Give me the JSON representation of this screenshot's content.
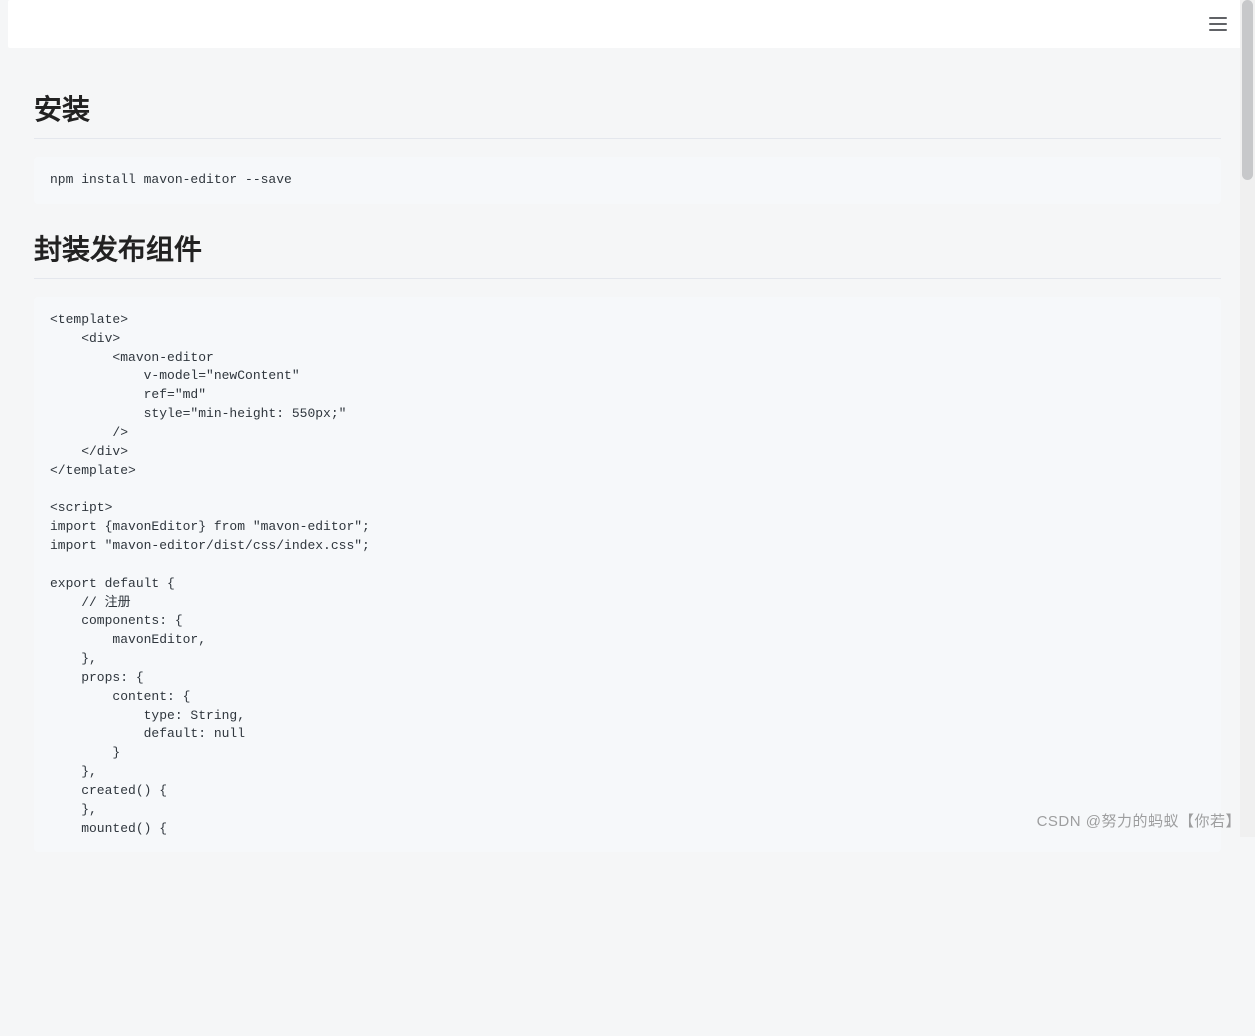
{
  "sections": {
    "install": {
      "title": "安装",
      "code": "npm install mavon-editor --save"
    },
    "component": {
      "title": "封装发布组件",
      "code": "<template>\n    <div>\n        <mavon-editor\n            v-model=\"newContent\"\n            ref=\"md\"\n            style=\"min-height: 550px;\"\n        />\n    </div>\n</template>\n\n<script>\nimport {mavonEditor} from \"mavon-editor\";\nimport \"mavon-editor/dist/css/index.css\";\n\nexport default {\n    // 注册\n    components: {\n        mavonEditor,\n    },\n    props: {\n        content: {\n            type: String,\n            default: null\n        }\n    },\n    created() {\n    },\n    mounted() {"
    }
  },
  "watermark": "CSDN @努力的蚂蚁【你若】"
}
